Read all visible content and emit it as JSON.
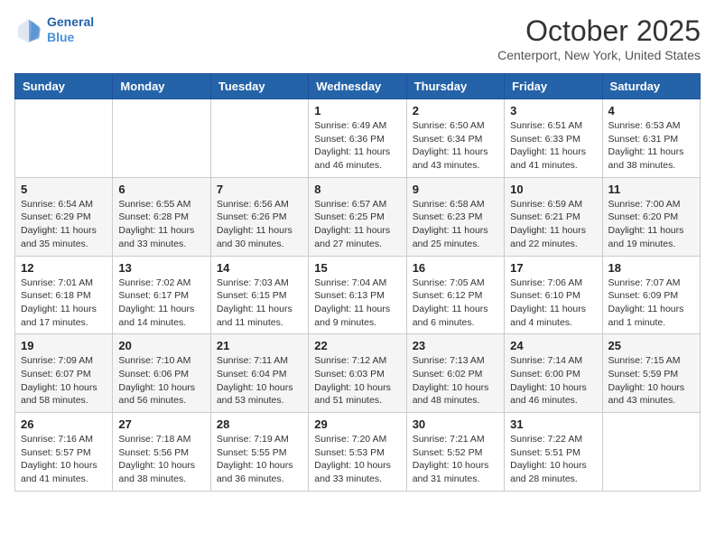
{
  "header": {
    "logo_line1": "General",
    "logo_line2": "Blue",
    "title": "October 2025",
    "subtitle": "Centerport, New York, United States"
  },
  "days_of_week": [
    "Sunday",
    "Monday",
    "Tuesday",
    "Wednesday",
    "Thursday",
    "Friday",
    "Saturday"
  ],
  "weeks": [
    [
      {
        "day": "",
        "info": ""
      },
      {
        "day": "",
        "info": ""
      },
      {
        "day": "",
        "info": ""
      },
      {
        "day": "1",
        "info": "Sunrise: 6:49 AM\nSunset: 6:36 PM\nDaylight: 11 hours and 46 minutes."
      },
      {
        "day": "2",
        "info": "Sunrise: 6:50 AM\nSunset: 6:34 PM\nDaylight: 11 hours and 43 minutes."
      },
      {
        "day": "3",
        "info": "Sunrise: 6:51 AM\nSunset: 6:33 PM\nDaylight: 11 hours and 41 minutes."
      },
      {
        "day": "4",
        "info": "Sunrise: 6:53 AM\nSunset: 6:31 PM\nDaylight: 11 hours and 38 minutes."
      }
    ],
    [
      {
        "day": "5",
        "info": "Sunrise: 6:54 AM\nSunset: 6:29 PM\nDaylight: 11 hours and 35 minutes."
      },
      {
        "day": "6",
        "info": "Sunrise: 6:55 AM\nSunset: 6:28 PM\nDaylight: 11 hours and 33 minutes."
      },
      {
        "day": "7",
        "info": "Sunrise: 6:56 AM\nSunset: 6:26 PM\nDaylight: 11 hours and 30 minutes."
      },
      {
        "day": "8",
        "info": "Sunrise: 6:57 AM\nSunset: 6:25 PM\nDaylight: 11 hours and 27 minutes."
      },
      {
        "day": "9",
        "info": "Sunrise: 6:58 AM\nSunset: 6:23 PM\nDaylight: 11 hours and 25 minutes."
      },
      {
        "day": "10",
        "info": "Sunrise: 6:59 AM\nSunset: 6:21 PM\nDaylight: 11 hours and 22 minutes."
      },
      {
        "day": "11",
        "info": "Sunrise: 7:00 AM\nSunset: 6:20 PM\nDaylight: 11 hours and 19 minutes."
      }
    ],
    [
      {
        "day": "12",
        "info": "Sunrise: 7:01 AM\nSunset: 6:18 PM\nDaylight: 11 hours and 17 minutes."
      },
      {
        "day": "13",
        "info": "Sunrise: 7:02 AM\nSunset: 6:17 PM\nDaylight: 11 hours and 14 minutes."
      },
      {
        "day": "14",
        "info": "Sunrise: 7:03 AM\nSunset: 6:15 PM\nDaylight: 11 hours and 11 minutes."
      },
      {
        "day": "15",
        "info": "Sunrise: 7:04 AM\nSunset: 6:13 PM\nDaylight: 11 hours and 9 minutes."
      },
      {
        "day": "16",
        "info": "Sunrise: 7:05 AM\nSunset: 6:12 PM\nDaylight: 11 hours and 6 minutes."
      },
      {
        "day": "17",
        "info": "Sunrise: 7:06 AM\nSunset: 6:10 PM\nDaylight: 11 hours and 4 minutes."
      },
      {
        "day": "18",
        "info": "Sunrise: 7:07 AM\nSunset: 6:09 PM\nDaylight: 11 hours and 1 minute."
      }
    ],
    [
      {
        "day": "19",
        "info": "Sunrise: 7:09 AM\nSunset: 6:07 PM\nDaylight: 10 hours and 58 minutes."
      },
      {
        "day": "20",
        "info": "Sunrise: 7:10 AM\nSunset: 6:06 PM\nDaylight: 10 hours and 56 minutes."
      },
      {
        "day": "21",
        "info": "Sunrise: 7:11 AM\nSunset: 6:04 PM\nDaylight: 10 hours and 53 minutes."
      },
      {
        "day": "22",
        "info": "Sunrise: 7:12 AM\nSunset: 6:03 PM\nDaylight: 10 hours and 51 minutes."
      },
      {
        "day": "23",
        "info": "Sunrise: 7:13 AM\nSunset: 6:02 PM\nDaylight: 10 hours and 48 minutes."
      },
      {
        "day": "24",
        "info": "Sunrise: 7:14 AM\nSunset: 6:00 PM\nDaylight: 10 hours and 46 minutes."
      },
      {
        "day": "25",
        "info": "Sunrise: 7:15 AM\nSunset: 5:59 PM\nDaylight: 10 hours and 43 minutes."
      }
    ],
    [
      {
        "day": "26",
        "info": "Sunrise: 7:16 AM\nSunset: 5:57 PM\nDaylight: 10 hours and 41 minutes."
      },
      {
        "day": "27",
        "info": "Sunrise: 7:18 AM\nSunset: 5:56 PM\nDaylight: 10 hours and 38 minutes."
      },
      {
        "day": "28",
        "info": "Sunrise: 7:19 AM\nSunset: 5:55 PM\nDaylight: 10 hours and 36 minutes."
      },
      {
        "day": "29",
        "info": "Sunrise: 7:20 AM\nSunset: 5:53 PM\nDaylight: 10 hours and 33 minutes."
      },
      {
        "day": "30",
        "info": "Sunrise: 7:21 AM\nSunset: 5:52 PM\nDaylight: 10 hours and 31 minutes."
      },
      {
        "day": "31",
        "info": "Sunrise: 7:22 AM\nSunset: 5:51 PM\nDaylight: 10 hours and 28 minutes."
      },
      {
        "day": "",
        "info": ""
      }
    ]
  ],
  "alt_rows": [
    false,
    true,
    false,
    true,
    false
  ]
}
